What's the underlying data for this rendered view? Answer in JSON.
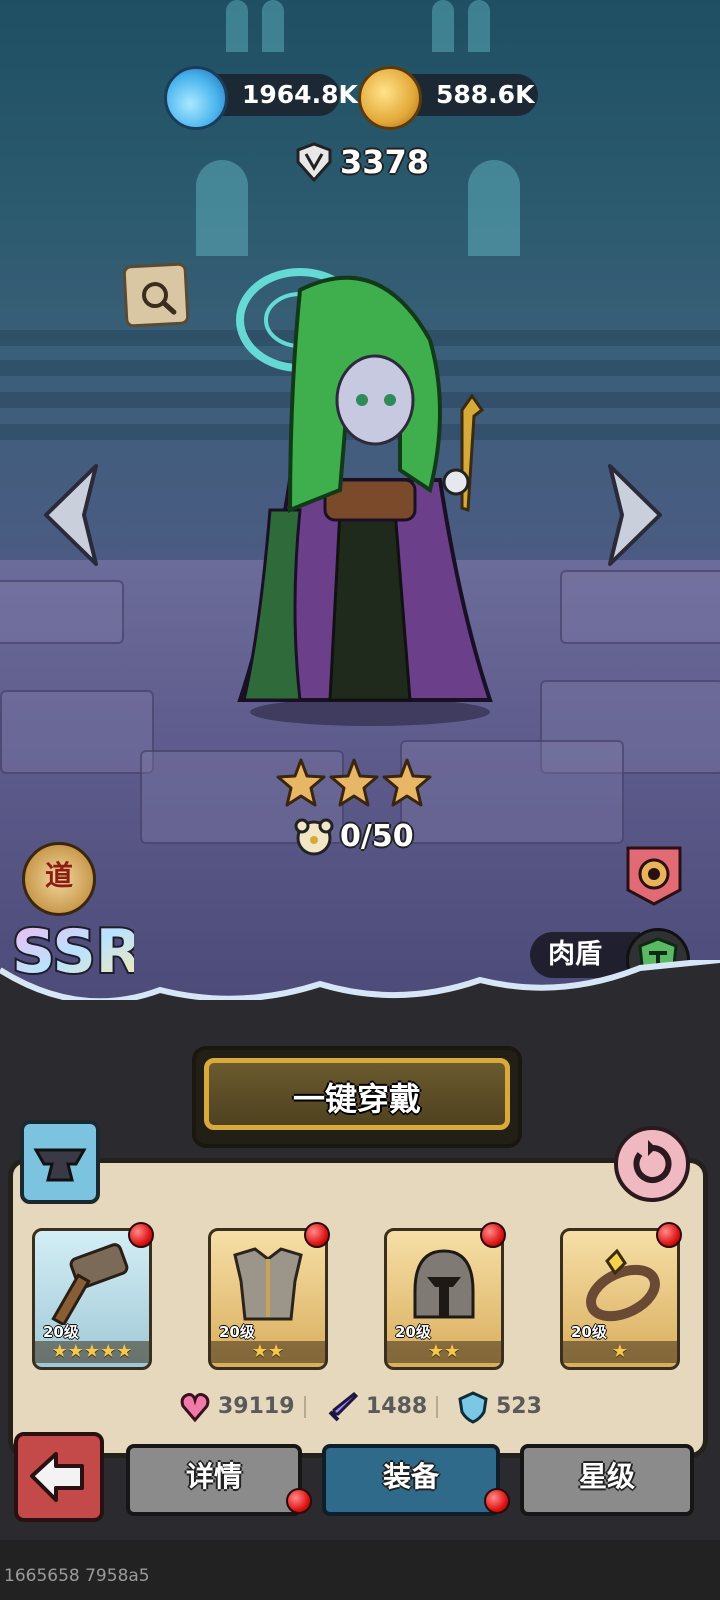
{
  "currencies": [
    {
      "name": "potion-icon",
      "value": "1964.8K"
    },
    {
      "name": "coin-icon",
      "value": "588.6K"
    }
  ],
  "power": {
    "value": "3378"
  },
  "hero": {
    "star_count": 3,
    "shards": "0/50",
    "faction_glyph": "道",
    "rarity": "SSR",
    "role": "肉盾"
  },
  "actions": {
    "one_click_equip": "一键穿戴"
  },
  "equipment": [
    {
      "slot": "weapon",
      "icon": "hammer-icon",
      "level": "20级",
      "stars": "★★★★★",
      "has_alert": true
    },
    {
      "slot": "armor",
      "icon": "chestplate-icon",
      "level": "20级",
      "stars": "★★",
      "has_alert": true
    },
    {
      "slot": "helmet",
      "icon": "helmet-icon",
      "level": "20级",
      "stars": "★★",
      "has_alert": true
    },
    {
      "slot": "accessory",
      "icon": "ring-icon",
      "level": "20级",
      "stars": "★",
      "has_alert": true
    }
  ],
  "stats": [
    {
      "name": "hp-icon",
      "value": "39119"
    },
    {
      "name": "attack-icon",
      "value": "1488"
    },
    {
      "name": "defense-icon",
      "value": "523"
    }
  ],
  "tabs": [
    {
      "label": "详情",
      "active": false
    },
    {
      "label": "装备",
      "active": true
    },
    {
      "label": "星级",
      "active": false
    }
  ],
  "footer": {
    "id": "1665658 7958a5"
  }
}
